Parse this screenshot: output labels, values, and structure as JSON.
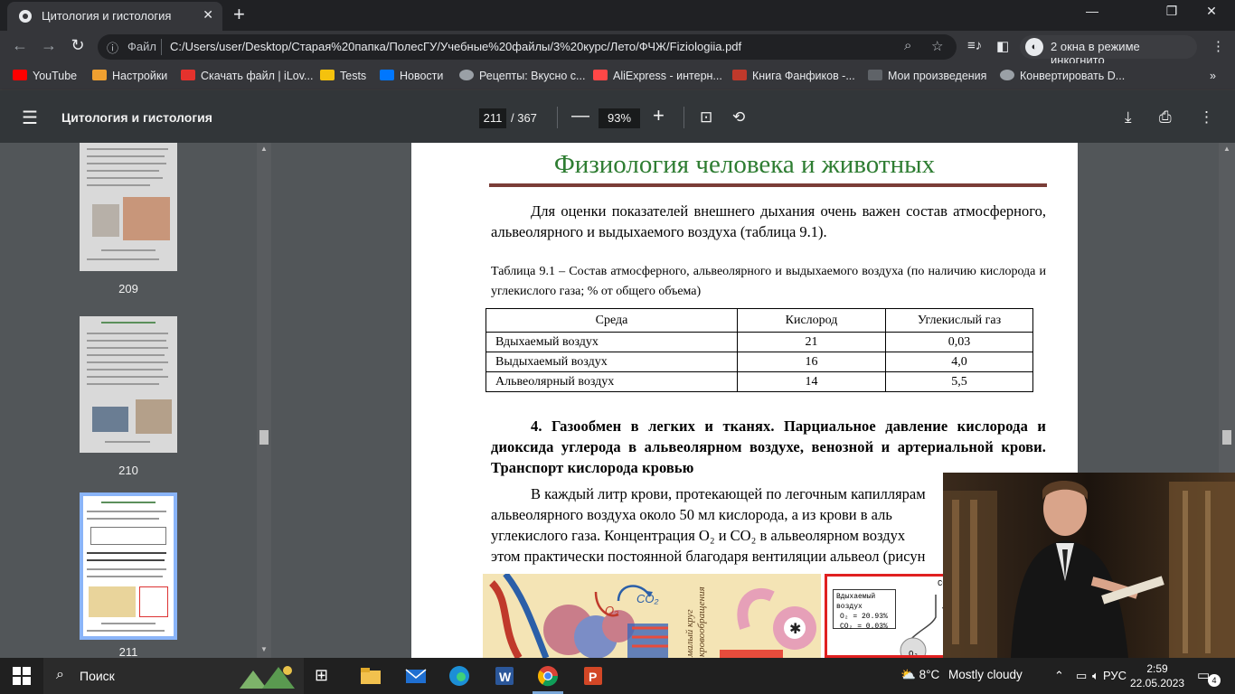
{
  "browser": {
    "tab_title": "Цитология и гистология",
    "tab_close": "✕",
    "new_tab": "+",
    "window_controls": {
      "minimize": "—",
      "restore": "❐",
      "close": "✕"
    },
    "address": {
      "info_label": "ⓘ",
      "scheme_label": "Файл",
      "url": "C:/Users/user/Desktop/Старая%20папка/ПолесГУ/Учебные%20файлы/3%20курс/Лето/ФЧЖ/Fiziologiia.pdf"
    },
    "incognito_label": "2 окна в режиме инкогнито",
    "bookmarks": [
      {
        "label": "YouTube",
        "color": "#ff0000"
      },
      {
        "label": "Настройки",
        "color": "#f0a030"
      },
      {
        "label": "Скачать файл | iLov...",
        "color": "#e5322d"
      },
      {
        "label": "Tests",
        "color": "#f4c20d"
      },
      {
        "label": "Новости",
        "color": "#0077ff"
      },
      {
        "label": "Рецепты: Вкусно с...",
        "color": "#9aa0a6"
      },
      {
        "label": "AliExpress - интерн...",
        "color": "#ff4747"
      },
      {
        "label": "Книга Фанфиков -...",
        "color": "#c0392b"
      },
      {
        "label": "Мои произведения",
        "color": "#5f6368"
      },
      {
        "label": "Конвертировать D...",
        "color": "#9aa0a6"
      }
    ]
  },
  "pdf_toolbar": {
    "doc_title": "Цитология и гистология",
    "current_page": "211",
    "total_pages": "/ 367",
    "zoom": "93%",
    "zoom_out": "—",
    "zoom_in": "+"
  },
  "sidebar": {
    "pages": [
      {
        "number": "209"
      },
      {
        "number": "210"
      },
      {
        "number": "211"
      }
    ]
  },
  "document": {
    "header": "Физиология человека и животных",
    "intro": "Для оценки показателей внешнего дыхания очень важен состав атмосферного, альвеолярного и выдыхаемого воздуха (таблица 9.1).",
    "table_caption": "Таблица 9.1 – Состав атмосферного, альвеолярного и выдыхаемого воздуха (по наличию кислорода и углекислого газа; % от общего объема)",
    "table": {
      "headers": [
        "Среда",
        "Кислород",
        "Углекислый газ"
      ],
      "rows": [
        [
          "Вдыхаемый воздух",
          "21",
          "0,03"
        ],
        [
          "Выдыхаемый воздух",
          "16",
          "4,0"
        ],
        [
          "Альвеолярный воздух",
          "14",
          "5,5"
        ]
      ]
    },
    "section_heading": "4. Газообмен в легких и тканях. Парциальное давление кислорода и диоксида углерода в альвеолярном воздухе, венозной и артериальной крови. Транспорт кислорода кровью",
    "body_line1": "В каждый литр крови, протекающей по легочным капиллярам",
    "body_line2": "альвеолярного воздуха около 50 мл кислорода, а из крови в аль",
    "body_line3": "углекислого газа. Концентрация O₂ и CO₂ в альвеолярном воздух",
    "body_line4": "этом практически постоянной благодаря вентиляции альвеол (рисун",
    "figure_left": {
      "o2": "O₂",
      "co2": "CO₂",
      "vertical_text_1": "малый круг",
      "vertical_text_2": "кровообращения"
    },
    "figure_right": {
      "box_title": "Вдыхаемый воздух",
      "o2_line": "O₂ = 20.93%",
      "co2_line": "CO₂ = 0.03%",
      "co2_label": "CO₂",
      "o2_label": "O₂"
    }
  },
  "taskbar": {
    "search_label": "Поиск",
    "weather_temp": "8°C",
    "weather_text": "Mostly cloudy",
    "language": "РУС",
    "time": "2:59",
    "date": "22.05.2023",
    "notifications": "4"
  }
}
